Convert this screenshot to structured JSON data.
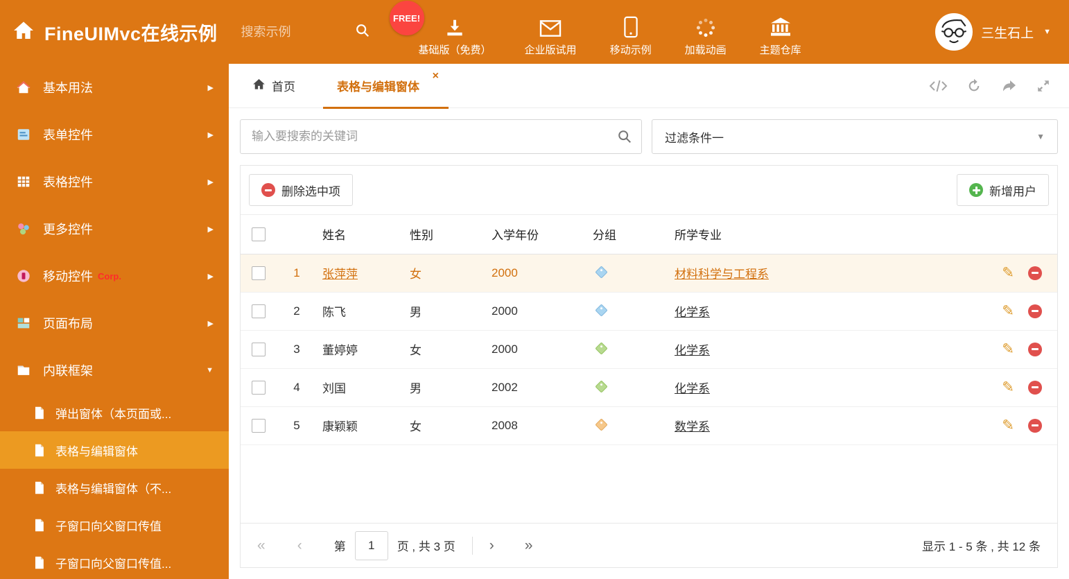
{
  "colors": {
    "accent_orange": "#dd7714",
    "active_text_orange": "#d2700e",
    "sidebar_active_bg": "#ec9a21",
    "selected_row_bg": "#fdf6ea",
    "free_badge_bg": "#fb4540",
    "tag_blue": "#a9d5f1",
    "tag_green": "#b8da90",
    "tag_orange": "#f6c88b",
    "delete_red": "#e0504d",
    "add_green": "#54b54e"
  },
  "header": {
    "title": "FineUIMvc在线示例",
    "search_placeholder": "搜索示例",
    "free_badge": "FREE!",
    "nav_items": [
      {
        "label": "基础版（免费）",
        "icon": "download-icon"
      },
      {
        "label": "企业版试用",
        "icon": "envelope-icon"
      },
      {
        "label": "移动示例",
        "icon": "mobile-icon"
      },
      {
        "label": "加载动画",
        "icon": "spinner-icon"
      },
      {
        "label": "主题仓库",
        "icon": "bank-icon"
      }
    ],
    "username": "三生石上",
    "user_caret": "▼"
  },
  "sidebar": {
    "items": [
      {
        "label": "基本用法",
        "icon": "home-icon",
        "arrow": "▶"
      },
      {
        "label": "表单控件",
        "icon": "form-icon",
        "arrow": "▶"
      },
      {
        "label": "表格控件",
        "icon": "table-icon",
        "arrow": "▶"
      },
      {
        "label": "更多控件",
        "icon": "widgets-icon",
        "arrow": "▶"
      },
      {
        "label": "移动控件",
        "badge": "Corp.",
        "icon": "mobile-circle-icon",
        "arrow": "▶"
      },
      {
        "label": "页面布局",
        "icon": "layout-icon",
        "arrow": "▶"
      },
      {
        "label": "内联框架",
        "icon": "frame-icon",
        "arrow": "▼",
        "expanded": true
      }
    ],
    "subitems": [
      {
        "label": "弹出窗体（本页面或..."
      },
      {
        "label": "表格与编辑窗体",
        "active": true
      },
      {
        "label": "表格与编辑窗体（不..."
      },
      {
        "label": "子窗口向父窗口传值"
      },
      {
        "label": "子窗口向父窗口传值..."
      }
    ]
  },
  "tabs": {
    "home": {
      "label": "首页",
      "icon": "home-icon"
    },
    "active": {
      "label": "表格与编辑窗体",
      "close": "×"
    }
  },
  "filter": {
    "search_placeholder": "输入要搜索的关键词",
    "dropdown_value": "过滤条件一",
    "caret": "▼"
  },
  "toolbar": {
    "delete_label": "删除选中项",
    "add_label": "新增用户"
  },
  "table": {
    "headers": {
      "name": "姓名",
      "gender": "性别",
      "year": "入学年份",
      "group": "分组",
      "major": "所学专业"
    },
    "edit_icon": "✎",
    "rows": [
      {
        "num": "1",
        "name": "张萍萍",
        "gender": "女",
        "year": "2000",
        "tag": "blue",
        "major": "材料科学与工程系",
        "selected": true
      },
      {
        "num": "2",
        "name": "陈飞",
        "gender": "男",
        "year": "2000",
        "tag": "blue",
        "major": "化学系",
        "selected": false
      },
      {
        "num": "3",
        "name": "董婷婷",
        "gender": "女",
        "year": "2000",
        "tag": "green",
        "major": "化学系",
        "selected": false
      },
      {
        "num": "4",
        "name": "刘国",
        "gender": "男",
        "year": "2002",
        "tag": "green",
        "major": "化学系",
        "selected": false
      },
      {
        "num": "5",
        "name": "康颖颖",
        "gender": "女",
        "year": "2008",
        "tag": "orange",
        "major": "数学系",
        "selected": false
      }
    ]
  },
  "pagination": {
    "first": "«",
    "prev": "‹",
    "next": "›",
    "last": "»",
    "page_label_before": "第",
    "page_value": "1",
    "page_label_after": "页 , 共 3 页",
    "summary": "显示 1 - 5 条 , 共 12 条"
  }
}
